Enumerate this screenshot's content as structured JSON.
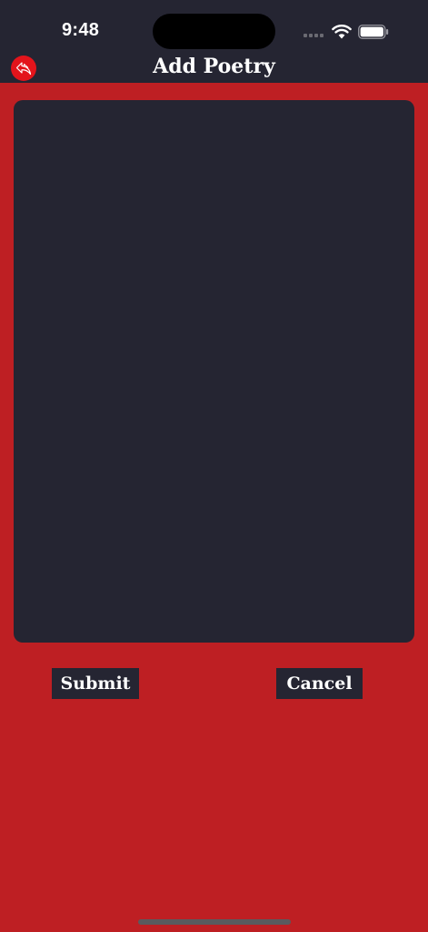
{
  "status_bar": {
    "time": "9:48",
    "icons": [
      "cellular-signal-icon",
      "wifi-icon",
      "battery-icon"
    ]
  },
  "header": {
    "title": "Add Poetry",
    "back_icon": "reply-arrow-icon"
  },
  "editor": {
    "value": "",
    "placeholder": ""
  },
  "actions": {
    "submit_label": "Submit",
    "cancel_label": "Cancel"
  },
  "colors": {
    "background": "#be1f23",
    "header": "#252532",
    "panel": "#252532",
    "back_button": "#e3141b",
    "text": "#ffffff"
  }
}
